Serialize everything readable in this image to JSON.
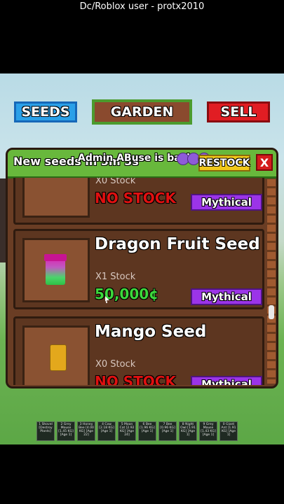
{
  "caption": "Dc/Roblox user - protx2010",
  "nav": {
    "seeds_label": "SEEDS",
    "garden_label": "GARDEN",
    "sell_label": "SELL"
  },
  "shop": {
    "header_text": "New seeds in 3m 3s",
    "admin_text": "Admin ABuse is back",
    "restock_label": "RESTOCK",
    "close_label": "X",
    "items": [
      {
        "name": "",
        "stock": "X0 Stock",
        "price": "NO STOCK",
        "rarity": "Mythical"
      },
      {
        "name": "Dragon Fruit Seed",
        "stock": "X1 Stock",
        "price": "50,000¢",
        "rarity": "Mythical"
      },
      {
        "name": "Mango Seed",
        "stock": "X0 Stock",
        "price": "NO STOCK",
        "rarity": "Mythical"
      }
    ]
  },
  "colors": {
    "no_stock": "#e01010",
    "price": "#3cd83c",
    "mythical": "#9b34e8"
  },
  "hotbar": [
    "1 Shovel [Destroy Plants]",
    "2 Grey Mouse [1.45 KG] [Age 1]",
    "3 Honey Bee [4.00 KG] [Age 22]",
    "4 Cow [2.18 KG] [Age 1]",
    "5 Moon Cat [2.92 KG] [Age 24]",
    "6 Bee [1.96 KG] [Age 1]",
    "7 Bee [0.96 KG] [Age 1]",
    "8 Night Owl [1.91 KG] [Age 1]",
    "9 Grey Mouse [1.43 KG] [Age 1]",
    "0 Giant Ant [1.91 KG] [Age 1]"
  ]
}
